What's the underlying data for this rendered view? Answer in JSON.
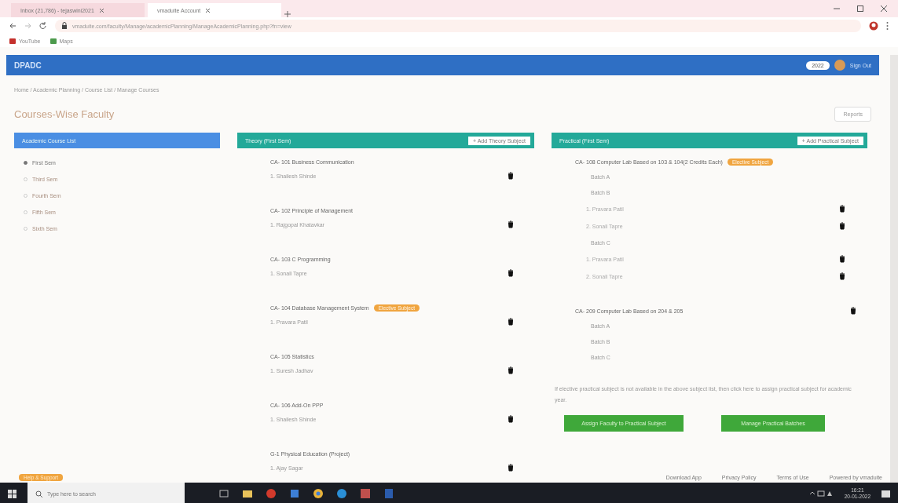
{
  "browser": {
    "tabs": [
      {
        "label": "Inbox (21,786) - tejaswini2021",
        "selected": false
      },
      {
        "label": "vmaduite Account",
        "selected": true
      }
    ],
    "url": "vmaduite.com/faculty/Manage/academicPlanning/ManageAcademicPlanning.php?fn=view",
    "bookmarks": [
      "YouTube",
      "Maps"
    ]
  },
  "header": {
    "brand": "DPADC",
    "year": "2022",
    "sign_out": "Sign Out"
  },
  "breadcrumb": "Home / Academic Planning / Course List / Manage Courses",
  "title": "Courses-Wise Faculty",
  "reports_button": "Reports",
  "semesters": {
    "heading": "Academic Course List",
    "items": [
      {
        "label": "First Sem",
        "selected": true
      },
      {
        "label": "Third Sem",
        "selected": false
      },
      {
        "label": "Fourth Sem",
        "selected": false
      },
      {
        "label": "Fifth Sem",
        "selected": false
      },
      {
        "label": "Sixth Sem",
        "selected": false
      }
    ]
  },
  "theory": {
    "heading": "Theory (First Sem)",
    "add_button": "+ Add Theory Subject",
    "subjects": [
      {
        "name": "CA- 101 Business Communication",
        "faculty": [
          "1. Shailesh Shinde"
        ]
      },
      {
        "name": "CA- 102 Principle of Management",
        "faculty": [
          "1. Rajgopal Khatavkar"
        ]
      },
      {
        "name": "CA- 103 C Programming",
        "faculty": [
          "1. Sonali Tapre"
        ]
      },
      {
        "name": "CA- 104 Database Management System",
        "badge": "Elective Subject",
        "faculty": [
          "1. Pravara Patil"
        ]
      },
      {
        "name": "CA- 105 Statistics",
        "faculty": [
          "1. Suresh Jadhav"
        ]
      },
      {
        "name": "CA- 106 Add-On PPP",
        "faculty": [
          "1. Shailesh Shinde"
        ]
      },
      {
        "name": "G-1 Physical Education (Project)",
        "faculty": [
          "1. Ajay Sagar"
        ]
      }
    ]
  },
  "practical": {
    "heading": "Practical (First Sem)",
    "add_button": "+ Add Practical Subject",
    "subjects": [
      {
        "name": "CA- 108 Computer Lab Based on 103 & 104(2 Credits Each)",
        "badge": "Elective Subject",
        "batches": [
          {
            "name": "Batch A"
          },
          {
            "name": "Batch B",
            "faculty": [
              "1. Pravara Patil",
              "2. Sonali Tapre"
            ]
          },
          {
            "name": "Batch C",
            "faculty": [
              "1. Pravara Patil",
              "2. Sonali Tapre"
            ]
          }
        ]
      },
      {
        "name": "CA- 209 Computer Lab Based on 204 & 205",
        "batches": [
          {
            "name": "Batch A"
          },
          {
            "name": "Batch B"
          },
          {
            "name": "Batch C"
          }
        ]
      }
    ],
    "note": "If elective practical subject is not available in the above subject list, then click here to assign practical subject for academic year.",
    "buttons": [
      "Assign Faculty to Practical Subject",
      "Manage Practical Batches"
    ]
  },
  "footer": {
    "badge": "Help & Support",
    "links": [
      "Download App",
      "Privacy Policy",
      "Terms of Use",
      "Powered by vmaduite"
    ]
  },
  "taskbar": {
    "search_placeholder": "Type here to search",
    "time": "16:21",
    "date": "20-01-2022"
  }
}
